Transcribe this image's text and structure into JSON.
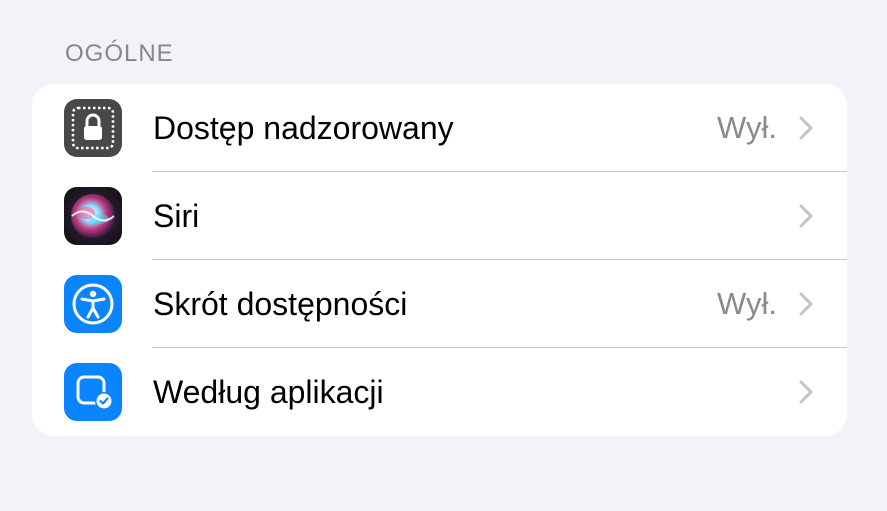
{
  "section": {
    "title": "OGÓLNE"
  },
  "rows": [
    {
      "label": "Dostęp nadzorowany",
      "value": "Wył.",
      "icon": "guided-access-lock-icon",
      "icon_color": "#48484a"
    },
    {
      "label": "Siri",
      "value": "",
      "icon": "siri-icon",
      "icon_color": "#1c1c1e"
    },
    {
      "label": "Skrót dostępności",
      "value": "Wył.",
      "icon": "accessibility-icon",
      "icon_color": "#0a84ff"
    },
    {
      "label": "Według aplikacji",
      "value": "",
      "icon": "per-app-settings-icon",
      "icon_color": "#0a84ff"
    }
  ],
  "colors": {
    "background": "#f2f2f7",
    "card": "#ffffff",
    "secondary_text": "#8a8a8e",
    "separator": "#c6c6c8",
    "chevron": "#c4c4c7"
  }
}
